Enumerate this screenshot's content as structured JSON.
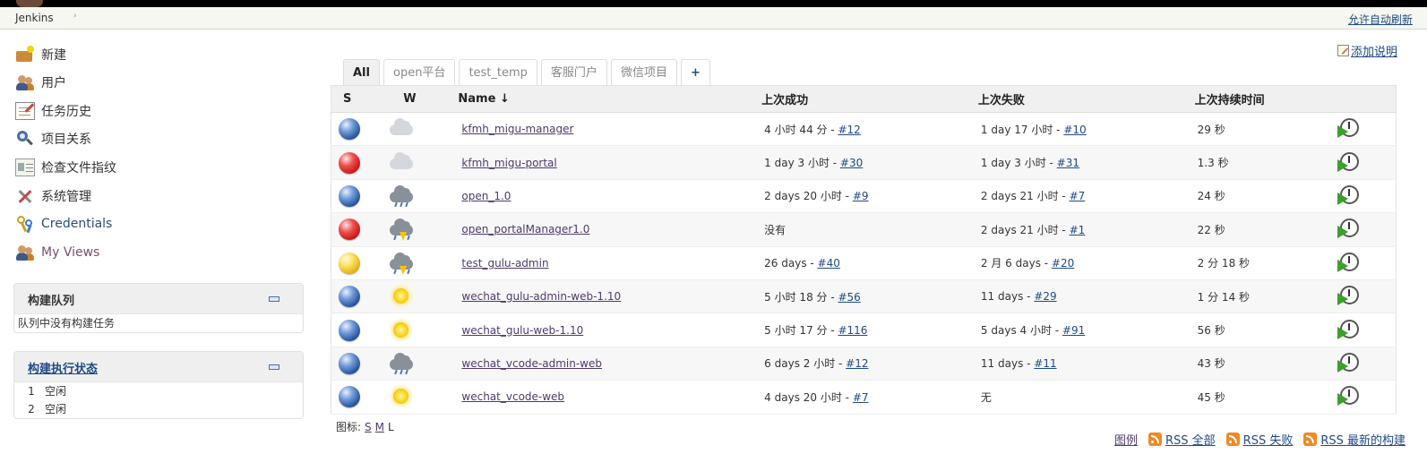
{
  "breadcrumb": {
    "root": "Jenkins",
    "separator": "›"
  },
  "header": {
    "autorefresh_label": "允许自动刷新"
  },
  "sidebar": {
    "tasks": [
      {
        "label": "新建",
        "icon": "new-item-icon"
      },
      {
        "label": "用户",
        "icon": "users-icon"
      },
      {
        "label": "任务历史",
        "icon": "notepad-icon"
      },
      {
        "label": "项目关系",
        "icon": "search-icon"
      },
      {
        "label": "检查文件指纹",
        "icon": "fingerprint-icon"
      },
      {
        "label": "系统管理",
        "icon": "tools-icon"
      },
      {
        "label": "Credentials",
        "icon": "credentials-icon"
      },
      {
        "label": "My Views",
        "icon": "users-icon"
      }
    ],
    "build_queue": {
      "title": "构建队列",
      "empty_text": "队列中没有构建任务"
    },
    "executors": {
      "title": "构建执行状态",
      "items": [
        {
          "num": "1",
          "status": "空闲"
        },
        {
          "num": "2",
          "status": "空闲"
        }
      ]
    }
  },
  "main": {
    "add_description": "添加说明",
    "tabs": [
      {
        "label": "All",
        "active": true
      },
      {
        "label": "open平台",
        "active": false
      },
      {
        "label": "test_temp",
        "active": false
      },
      {
        "label": "客服门户",
        "active": false
      },
      {
        "label": "微信项目",
        "active": false
      },
      {
        "label": "+",
        "active": false
      }
    ],
    "columns": {
      "s": "S",
      "w": "W",
      "name": "Name",
      "sort_arrow": "↓",
      "last_success": "上次成功",
      "last_failure": "上次失败",
      "last_duration": "上次持续时间"
    },
    "jobs": [
      {
        "status": "blue",
        "weather": "cloudy",
        "name": "kfmh_migu-manager",
        "success_time": "4 小时 44 分 - ",
        "success_build": "#12",
        "failure_time": "1 day 17 小时 - ",
        "failure_build": "#10",
        "duration": "29 秒"
      },
      {
        "status": "red",
        "weather": "cloudy",
        "name": "kfmh_migu-portal",
        "success_time": "1 day 3 小时 - ",
        "success_build": "#30",
        "failure_time": "1 day 3 小时 - ",
        "failure_build": "#31",
        "duration": "1.3 秒"
      },
      {
        "status": "blue",
        "weather": "rain",
        "name": "open_1.0",
        "success_time": "2 days 20 小时 - ",
        "success_build": "#9",
        "failure_time": "2 days 21 小时 - ",
        "failure_build": "#7",
        "duration": "24 秒"
      },
      {
        "status": "red",
        "weather": "storm",
        "name": "open_portalManager1.0",
        "success_time": "没有",
        "success_build": "",
        "failure_time": "2 days 21 小时 - ",
        "failure_build": "#1",
        "duration": "22 秒"
      },
      {
        "status": "yellow",
        "weather": "storm",
        "name": "test_gulu-admin",
        "success_time": "26 days - ",
        "success_build": "#40",
        "failure_time": "2 月 6 days - ",
        "failure_build": "#20",
        "duration": "2 分 18 秒"
      },
      {
        "status": "blue",
        "weather": "sunny",
        "name": "wechat_gulu-admin-web-1.10",
        "success_time": "5 小时 18 分 - ",
        "success_build": "#56",
        "failure_time": "11 days - ",
        "failure_build": "#29",
        "duration": "1 分 14 秒"
      },
      {
        "status": "blue",
        "weather": "sunny",
        "name": "wechat_gulu-web-1.10",
        "success_time": "5 小时 17 分 - ",
        "success_build": "#116",
        "failure_time": "5 days 4 小时 - ",
        "failure_build": "#91",
        "duration": "56 秒"
      },
      {
        "status": "blue",
        "weather": "rain",
        "name": "wechat_vcode-admin-web",
        "success_time": "6 days 2 小时 - ",
        "success_build": "#12",
        "failure_time": "11 days - ",
        "failure_build": "#11",
        "duration": "43 秒"
      },
      {
        "status": "blue",
        "weather": "sunny",
        "name": "wechat_vcode-web",
        "success_time": "4 days 20 小时 - ",
        "success_build": "#7",
        "failure_time": "无",
        "failure_build": "",
        "duration": "45 秒"
      }
    ],
    "icon_size": {
      "label": "图标:",
      "s": "S",
      "m": "M",
      "l": "L"
    },
    "footer": {
      "legend": "图例",
      "rss_all": "RSS 全部",
      "rss_failed": "RSS 失败",
      "rss_latest": "RSS 最新的构建"
    }
  }
}
